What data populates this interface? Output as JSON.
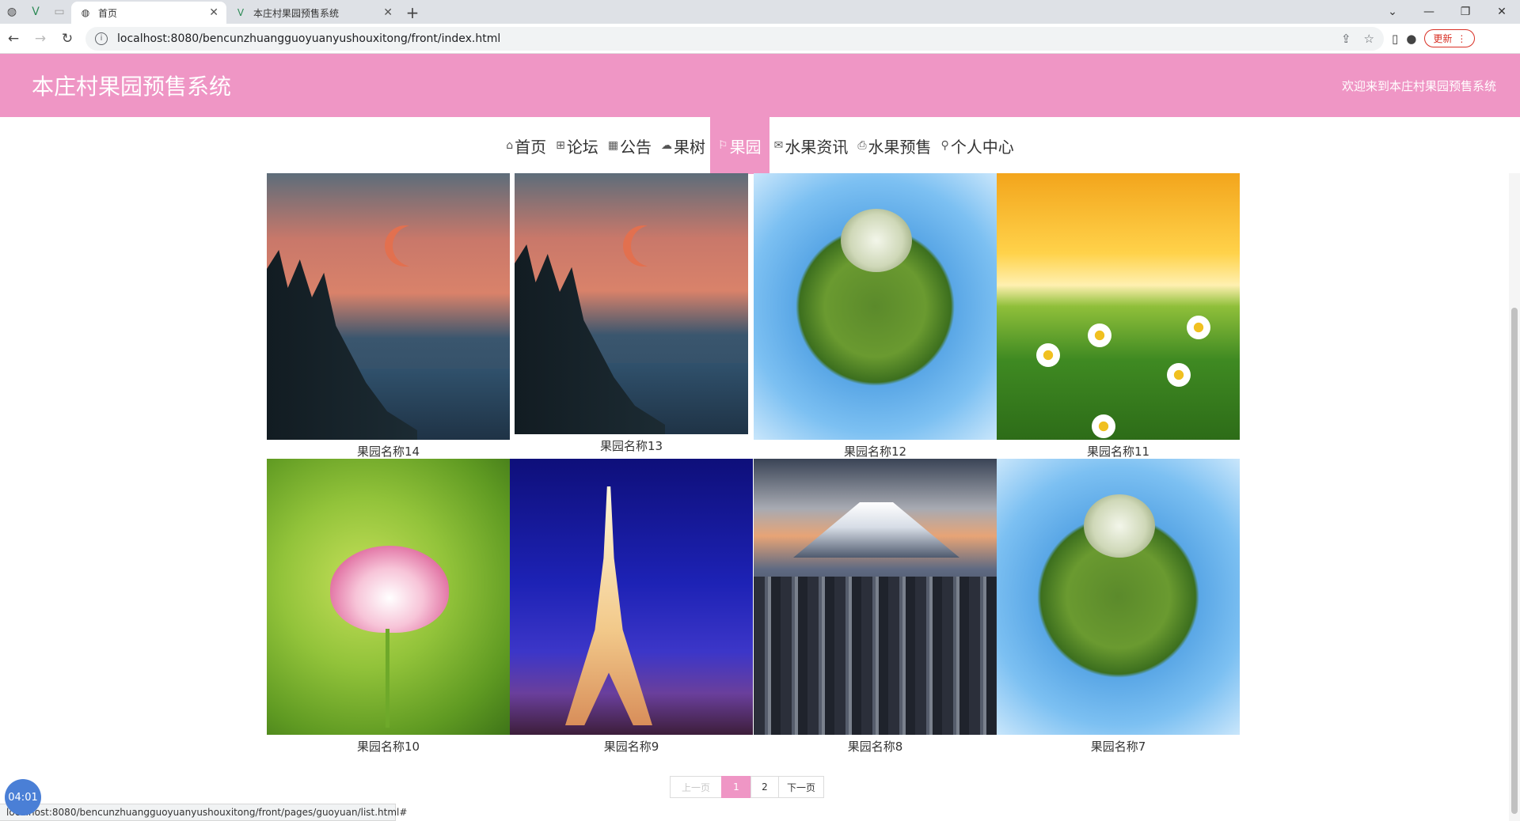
{
  "browser": {
    "tabs": [
      {
        "title": "首页",
        "active": true
      },
      {
        "title": "本庄村果园预售系统",
        "active": false
      }
    ],
    "url": "localhost:8080/bencunzhuangguoyuanyushouxitong/front/index.html",
    "update_label": "更新",
    "status_url": "localhost:8080/bencunzhuangguoyuanyushouxitong/front/pages/guoyuan/list.html#"
  },
  "header": {
    "title": "本庄村果园预售系统",
    "welcome": "欢迎来到本庄村果园预售系统"
  },
  "nav": {
    "items": [
      {
        "label": "首页",
        "icon": "home-icon",
        "active": false
      },
      {
        "label": "论坛",
        "icon": "forum-icon",
        "active": false
      },
      {
        "label": "公告",
        "icon": "notice-icon",
        "active": false
      },
      {
        "label": "果树",
        "icon": "cloud-icon",
        "active": false
      },
      {
        "label": "果园",
        "icon": "flag-icon",
        "active": true
      },
      {
        "label": "水果资讯",
        "icon": "mail-icon",
        "active": false
      },
      {
        "label": "水果预售",
        "icon": "print-icon",
        "active": false
      },
      {
        "label": "个人中心",
        "icon": "user-icon",
        "active": false
      }
    ]
  },
  "orchards": [
    {
      "name": "果园名称14",
      "image": "sunset-lake"
    },
    {
      "name": "果园名称13",
      "image": "sunset-lake"
    },
    {
      "name": "果园名称12",
      "image": "tiny-planet"
    },
    {
      "name": "果园名称11",
      "image": "daisy-field"
    },
    {
      "name": "果园名称10",
      "image": "lotus"
    },
    {
      "name": "果园名称9",
      "image": "eiffel-tower"
    },
    {
      "name": "果园名称8",
      "image": "fuji-city"
    },
    {
      "name": "果园名称7",
      "image": "tiny-planet"
    }
  ],
  "pagination": {
    "prev": "上一页",
    "pages": [
      "1",
      "2"
    ],
    "current": "1",
    "next": "下一页"
  },
  "timer": "04:01",
  "colors": {
    "accent": "#ef96c5",
    "header_text": "#ffffff"
  }
}
